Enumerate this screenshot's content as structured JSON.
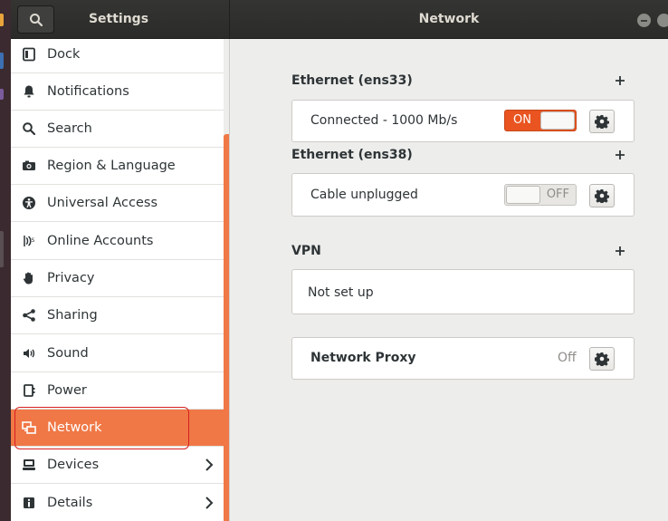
{
  "header": {
    "app_title": "Settings",
    "panel_title": "Network"
  },
  "sidebar": {
    "items": [
      {
        "label": "Dock",
        "icon": "dock-icon"
      },
      {
        "label": "Notifications",
        "icon": "bell-icon"
      },
      {
        "label": "Search",
        "icon": "search-icon"
      },
      {
        "label": "Region & Language",
        "icon": "camera-flag-icon"
      },
      {
        "label": "Universal Access",
        "icon": "accessibility-icon"
      },
      {
        "label": "Online Accounts",
        "icon": "online-accounts-icon"
      },
      {
        "label": "Privacy",
        "icon": "hand-icon"
      },
      {
        "label": "Sharing",
        "icon": "share-icon"
      },
      {
        "label": "Sound",
        "icon": "speaker-icon"
      },
      {
        "label": "Power",
        "icon": "power-plug-icon"
      },
      {
        "label": "Network",
        "icon": "network-icon",
        "selected": true
      },
      {
        "label": "Devices",
        "icon": "devices-icon",
        "has_submenu": true
      },
      {
        "label": "Details",
        "icon": "info-icon",
        "has_submenu": true
      }
    ]
  },
  "network": {
    "ethernet1": {
      "title": "Ethernet (ens33)",
      "status": "Connected - 1000 Mb/s",
      "switch_label": "ON"
    },
    "ethernet2": {
      "title": "Ethernet (ens38)",
      "status": "Cable unplugged",
      "switch_label": "OFF"
    },
    "vpn": {
      "title": "VPN",
      "status": "Not set up"
    },
    "proxy": {
      "label": "Network Proxy",
      "state": "Off"
    }
  },
  "colors": {
    "accent": "#e95420",
    "selection": "#f07846",
    "header": "#2f2f2d"
  }
}
